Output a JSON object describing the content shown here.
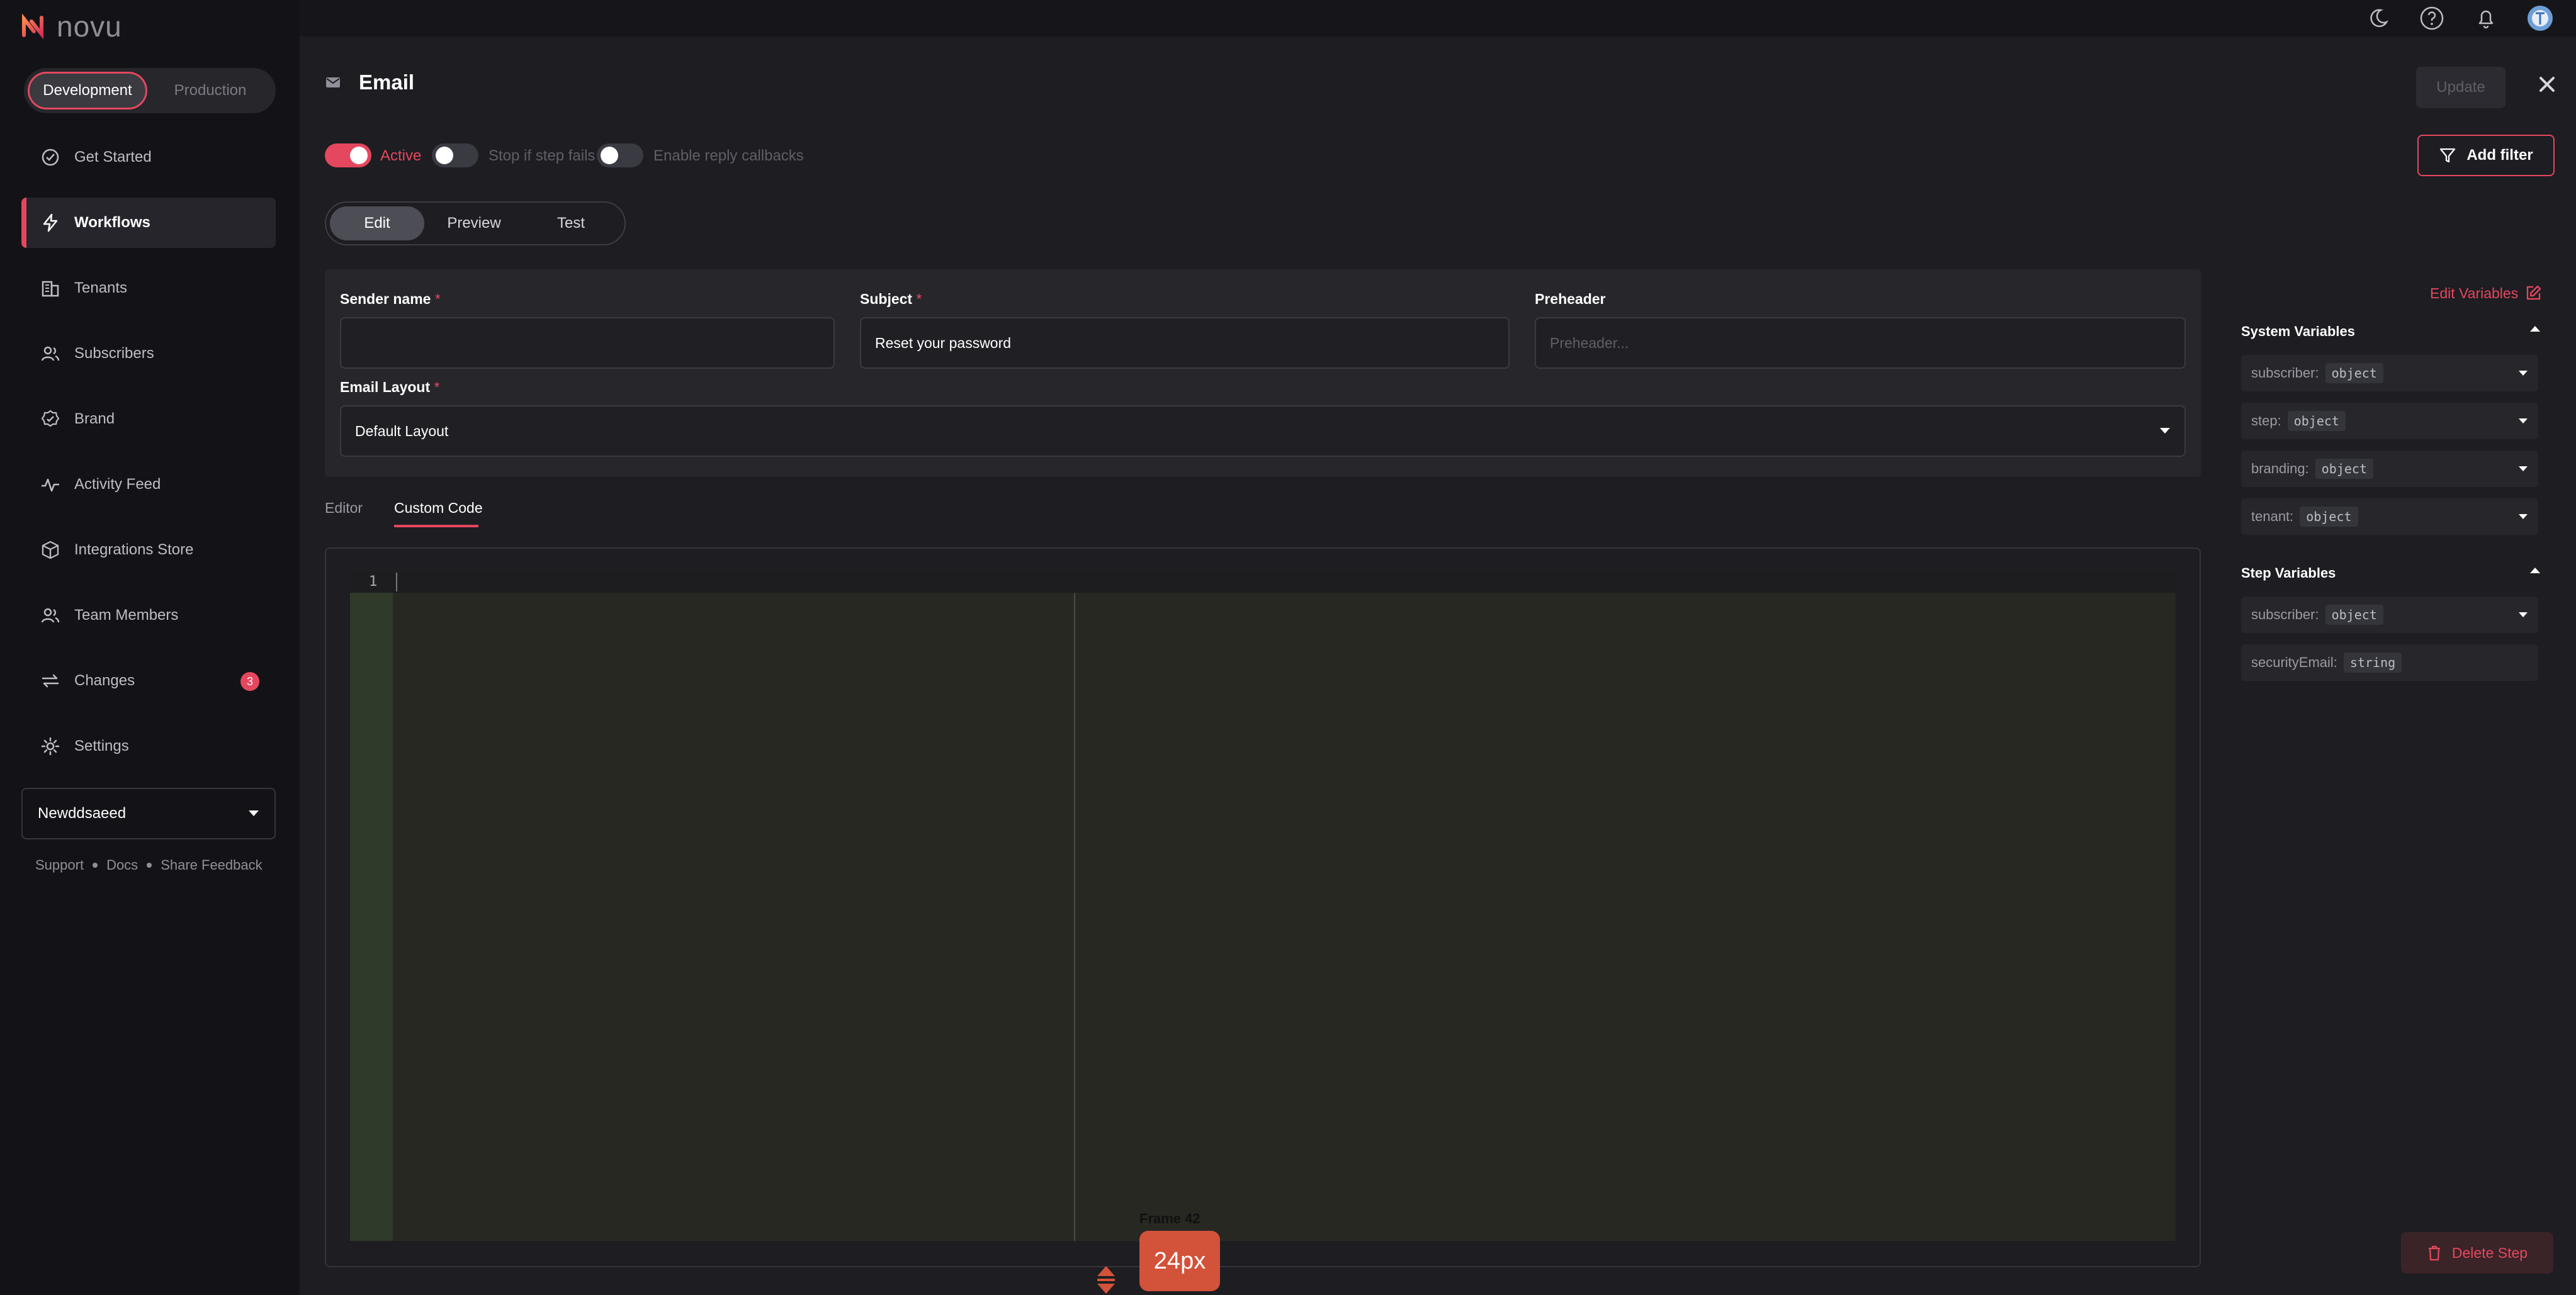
{
  "app": {
    "logo_text": "novu",
    "brand_color": "#e5475e"
  },
  "environment": {
    "options": [
      "Development",
      "Production"
    ],
    "selected": "Development"
  },
  "sidebar": {
    "items": [
      {
        "label": "Get Started",
        "icon": "check-circle-icon"
      },
      {
        "label": "Workflows",
        "icon": "bolt-icon",
        "active": true
      },
      {
        "label": "Tenants",
        "icon": "building-icon"
      },
      {
        "label": "Subscribers",
        "icon": "users-icon"
      },
      {
        "label": "Brand",
        "icon": "badge-check-icon"
      },
      {
        "label": "Activity Feed",
        "icon": "activity-icon"
      },
      {
        "label": "Integrations Store",
        "icon": "box-icon"
      },
      {
        "label": "Team Members",
        "icon": "team-icon"
      },
      {
        "label": "Changes",
        "icon": "swap-icon",
        "badge": "3"
      },
      {
        "label": "Settings",
        "icon": "gear-icon"
      }
    ],
    "organization": "Newddsaeed",
    "footer_links": [
      "Support",
      "Docs",
      "Share Feedback"
    ]
  },
  "topbar": {
    "icons": [
      "moon-icon",
      "help-icon",
      "bell-icon",
      "avatar"
    ]
  },
  "step": {
    "channel_icon": "mail-icon",
    "title": "Email",
    "update_label": "Update",
    "toggles": [
      {
        "label": "Active",
        "on": true
      },
      {
        "label": "Stop if step fails",
        "on": false
      },
      {
        "label": "Enable reply callbacks",
        "on": false
      }
    ],
    "add_filter_label": "Add filter",
    "mode_tabs": [
      "Edit",
      "Preview",
      "Test"
    ],
    "active_mode": "Edit",
    "delete_label": "Delete Step"
  },
  "form": {
    "sender_name": {
      "label": "Sender name",
      "required": "*",
      "value": ""
    },
    "subject": {
      "label": "Subject",
      "required": "*",
      "value": "Reset your password"
    },
    "preheader": {
      "label": "Preheader",
      "placeholder": "Preheader..."
    },
    "email_layout": {
      "label": "Email Layout",
      "required": "*",
      "value": "Default Layout"
    }
  },
  "editor": {
    "tabs": [
      "Editor",
      "Custom Code"
    ],
    "active_tab": "Custom Code",
    "line_numbers": [
      "1"
    ],
    "resize_label": "24px",
    "frame_label": "Frame 42"
  },
  "variables": {
    "edit_label": "Edit Variables",
    "system_title": "System Variables",
    "system": [
      {
        "name": "subscriber:",
        "type": "object"
      },
      {
        "name": "step:",
        "type": "object"
      },
      {
        "name": "branding:",
        "type": "object"
      },
      {
        "name": "tenant:",
        "type": "object"
      }
    ],
    "step_title": "Step Variables",
    "step": [
      {
        "name": "subscriber:",
        "type": "object"
      },
      {
        "name": "securityEmail:",
        "type": "string"
      }
    ]
  }
}
